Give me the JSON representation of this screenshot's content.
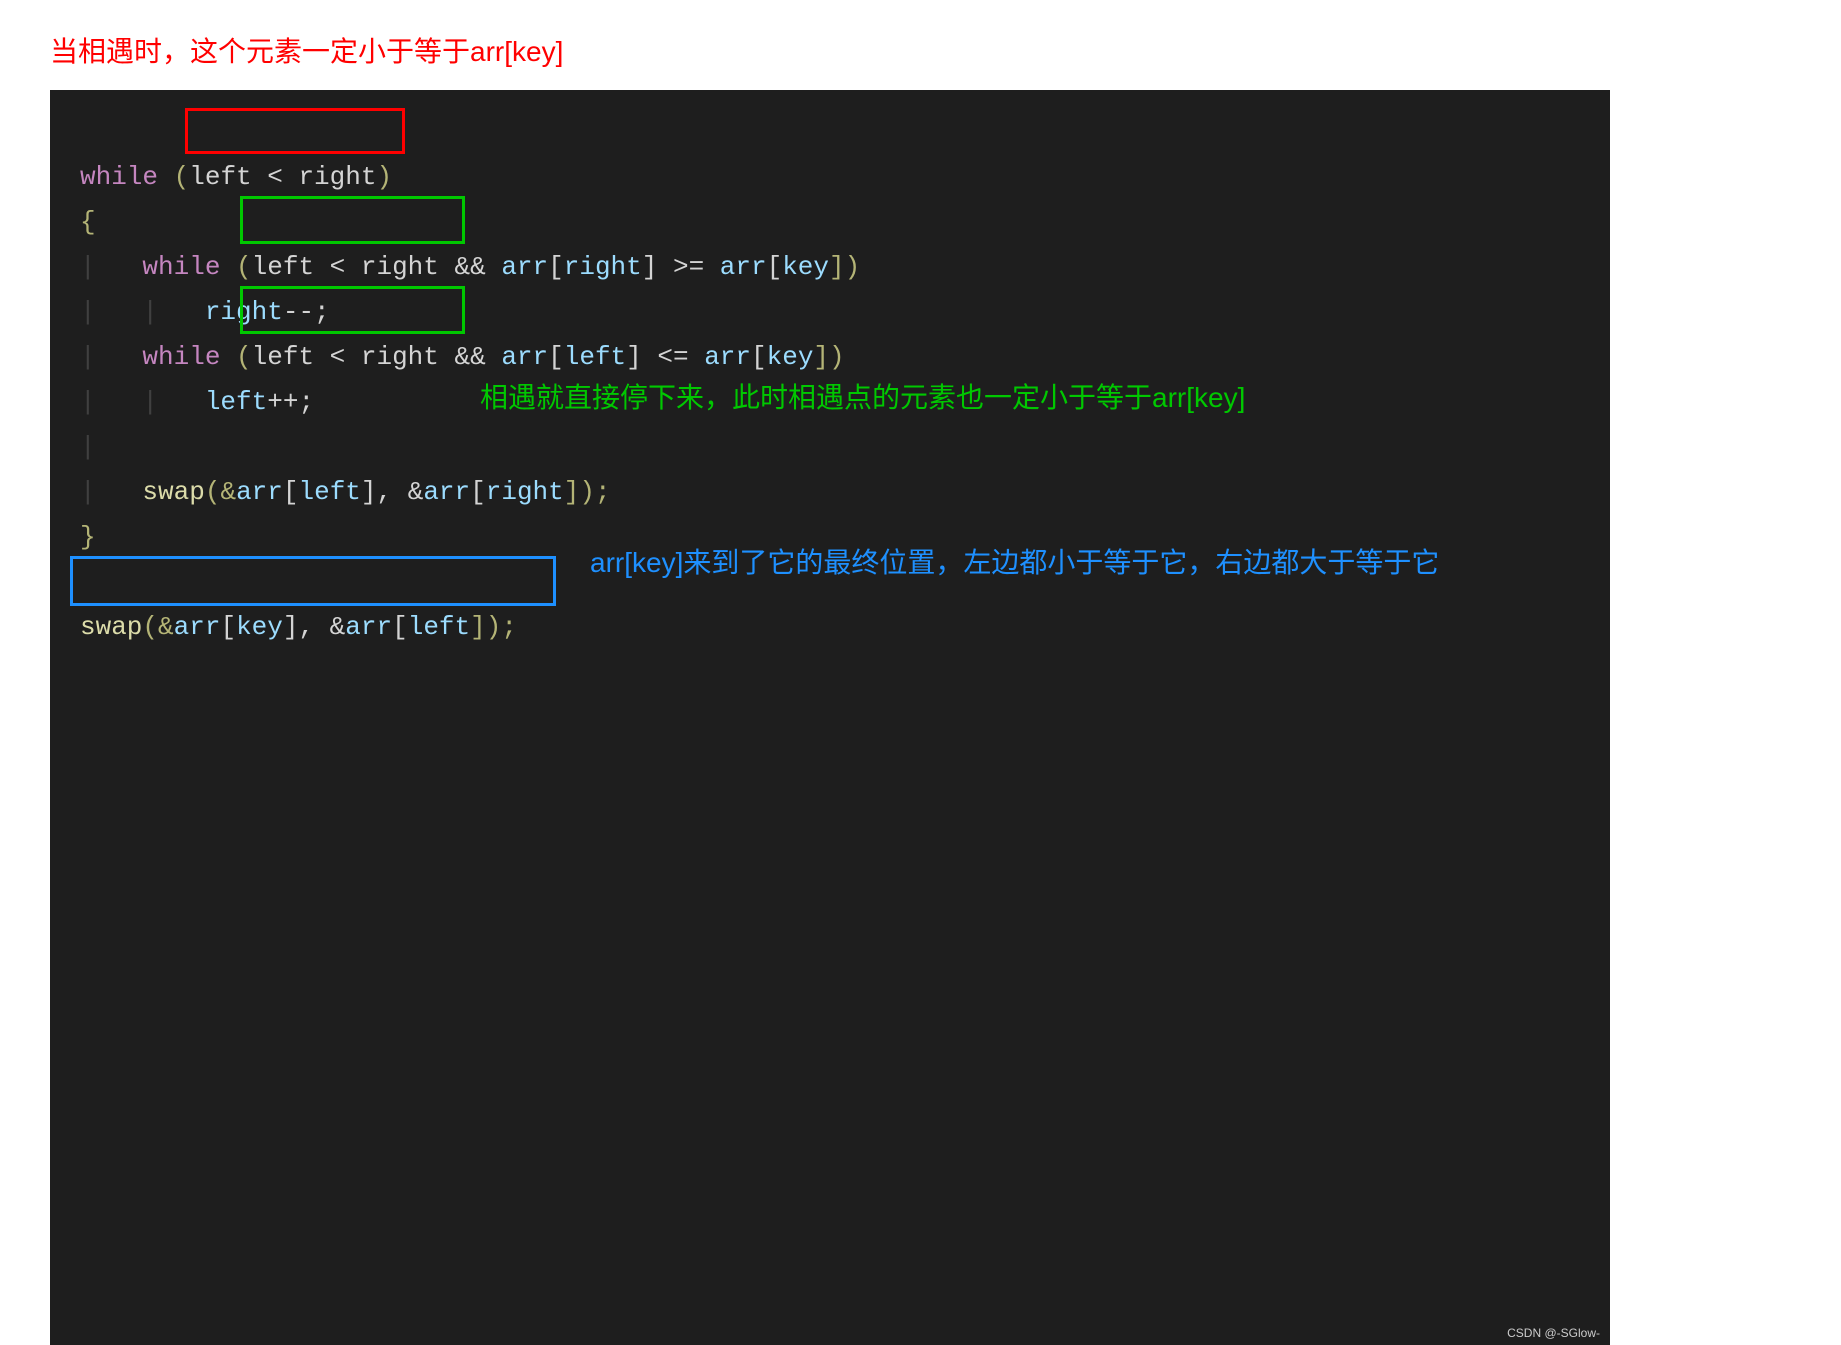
{
  "annotations": {
    "top_red": "当相遇时，这个元素一定小于等于arr[key]",
    "green_meet": "相遇就直接停下来，此时相遇点的元素也一定小于等于arr[key]",
    "blue_final": "arr[key]来到了它的最终位置，左边都小于等于它，右边都大于等于它"
  },
  "code": {
    "line1": {
      "while": "while",
      "lp": " (",
      "cond": "left < right",
      "rp": ")"
    },
    "line2": "{",
    "line3": {
      "while": "while",
      "lp": " (",
      "cond": "left < right",
      "amp": " && ",
      "arr1": "arr",
      "lb1": "[",
      "p1": "right",
      "rb1": "]",
      "cmp": " >= ",
      "arr2": "arr",
      "lb2": "[",
      "p2": "key",
      "rb2": "])"
    },
    "line4": {
      "stmt1": "right",
      "stmt2": "--;"
    },
    "line5": {
      "while": "while",
      "lp": " (",
      "cond": "left < right",
      "amp": " && ",
      "arr1": "arr",
      "lb1": "[",
      "p1": "left",
      "rb1": "]",
      "cmp": " <= ",
      "arr2": "arr",
      "lb2": "[",
      "p2": "key",
      "rb2": "])"
    },
    "line6": {
      "stmt1": "left",
      "stmt2": "++;"
    },
    "line8": {
      "fn": "swap",
      "lp": "(&",
      "a": "arr",
      "l1": "[",
      "p1": "left",
      "r1": "], &",
      "a2": "arr",
      "l2": "[",
      "p2": "right",
      "r2": "]);"
    },
    "line9": "}",
    "line11": {
      "fn": "swap",
      "lp": "(&",
      "a": "arr",
      "l1": "[",
      "p1": "key",
      "r1": "], &",
      "a2": "arr",
      "l2": "[",
      "p2": "left",
      "r2": "]);"
    }
  },
  "watermark": "CSDN @-SGlow-"
}
